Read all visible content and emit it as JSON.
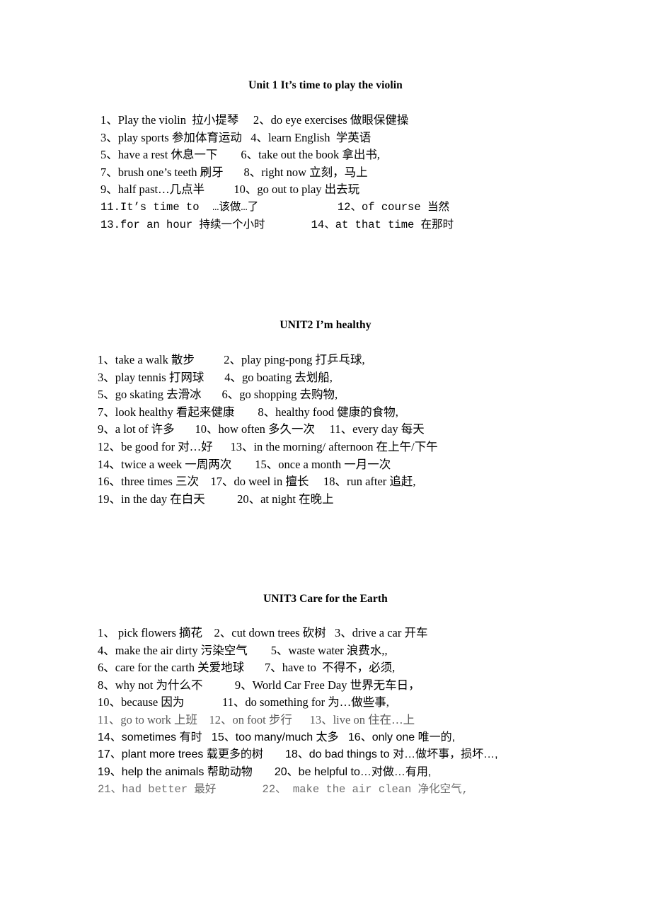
{
  "document": {
    "page_background": "#ffffff",
    "text_color": "#000000",
    "faded_text_color": "#6f6f6f"
  },
  "units": [
    {
      "id": "unit1",
      "heading": "Unit 1 It’s time to play the violin",
      "lines": [
        {
          "text": "1、Play the violin  拉小提琴     2、do eye exercises 做眼保健操",
          "font": "serif",
          "tone": "normal"
        },
        {
          "text": "3、play sports 参加体育运动   4、learn English  学英语",
          "font": "serif",
          "tone": "normal"
        },
        {
          "text": "5、have a rest 休息一下        6、take out the book 拿出书,",
          "font": "serif",
          "tone": "normal"
        },
        {
          "text": "7、brush one’s teeth 刷牙       8、right now 立刻，马上",
          "font": "serif",
          "tone": "normal"
        },
        {
          "text": "9、half past…几点半          10、go out to play 出去玩",
          "font": "serif",
          "tone": "normal"
        },
        {
          "text": "11.It’s time to  …该做…了            12、of course 当然",
          "font": "serif-mono-mixed",
          "tone": "normal",
          "mono_from": 24
        },
        {
          "text": "13.for an hour 持续一个小时       14、at that time 在那时",
          "font": "serif-mono-mixed",
          "tone": "normal",
          "mono_from": 3
        }
      ]
    },
    {
      "id": "unit2",
      "heading": "UNIT2 I’m healthy",
      "lines": [
        {
          "text": "1、take a walk 散步          2、play ping-pong 打乒乓球,",
          "font": "serif",
          "tone": "normal"
        },
        {
          "text": "3、play tennis 打网球       4、go boating 去划船,",
          "font": "serif",
          "tone": "normal"
        },
        {
          "text": "5、go skating 去滑冰       6、go shopping 去购物,",
          "font": "serif",
          "tone": "normal"
        },
        {
          "text": "7、look healthy 看起来健康        8、healthy food 健康的食物,",
          "font": "serif",
          "tone": "normal"
        },
        {
          "text": "9、a lot of 许多       10、how often 多久一次     11、every day 每天",
          "font": "serif",
          "tone": "normal"
        },
        {
          "text": "12、be good for 对…好      13、in the morning/ afternoon 在上午/下午",
          "font": "serif",
          "tone": "normal"
        },
        {
          "text": "14、twice a week 一周两次        15、once a month 一月一次",
          "font": "serif",
          "tone": "normal"
        },
        {
          "text": "16、three times 三次    17、do weel in 擅长     18、run after 追赶,",
          "font": "serif",
          "tone": "normal"
        },
        {
          "text": "19、in the day 在白天           20、at night 在晚上",
          "font": "serif",
          "tone": "normal"
        }
      ]
    },
    {
      "id": "unit3",
      "heading": "UNIT3 Care for the Earth",
      "lines": [
        {
          "text": "1、 pick flowers 摘花    2、cut down trees 砍树   3、drive a car 开车",
          "font": "serif",
          "tone": "normal"
        },
        {
          "text": "4、make the air dirty 污染空气        5、waste water 浪费水,,",
          "font": "serif",
          "tone": "normal"
        },
        {
          "text": "6、care for the carth 关爱地球       7、have to  不得不，必须,",
          "font": "serif",
          "tone": "normal"
        },
        {
          "text": "8、why not 为什么不           9、World Car Free Day 世界无车日，",
          "font": "serif",
          "tone": "normal"
        },
        {
          "text": "10、because 因为             11、do something for 为…做些事,",
          "font": "serif",
          "tone": "normal"
        },
        {
          "text": "11、go to work 上班    12、on foot 步行      13、live on 住在…上",
          "font": "serif",
          "tone": "light"
        },
        {
          "text": "14、sometimes 有时   15、too many/much 太多   16、only one 唯一的,",
          "font": "sans",
          "tone": "normal"
        },
        {
          "text": "17、plant more trees 载更多的树       18、do bad things to 对…做坏事，损坏…,",
          "font": "sans-serif-mixed",
          "tone": "normal",
          "serif_from": 22
        },
        {
          "text": "19、help the animals 帮助动物       20、be helpful to…对做…有用,",
          "font": "sans-serif-mixed",
          "tone": "normal",
          "serif_from": 24
        },
        {
          "text": "21、had better 最好       22、 make the air clean 净化空气,",
          "font": "mono",
          "tone": "light"
        }
      ]
    }
  ]
}
